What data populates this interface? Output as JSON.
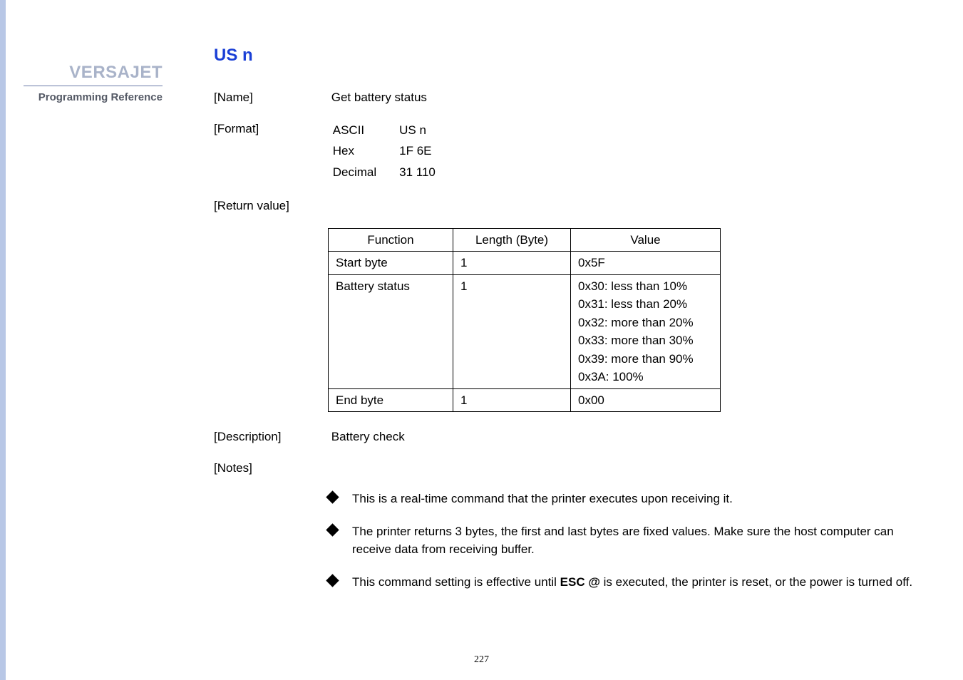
{
  "sidebar": {
    "brand": "VERSAJET",
    "subtitle": "Programming Reference"
  },
  "title": "US n",
  "name": {
    "label": "[Name]",
    "value": "Get battery status"
  },
  "format": {
    "label": "[Format]",
    "rows": [
      {
        "enc": "ASCII",
        "val": "US n"
      },
      {
        "enc": "Hex",
        "val": "1F 6E"
      },
      {
        "enc": "Decimal",
        "val": "31 110"
      }
    ]
  },
  "return_value": {
    "label": "[Return value]",
    "headers": {
      "func": "Function",
      "len": "Length (Byte)",
      "val": "Value"
    },
    "rows": [
      {
        "func": "Start byte",
        "len": "1",
        "val": [
          "0x5F"
        ]
      },
      {
        "func": "Battery status",
        "len": "1",
        "val": [
          "0x30: less than 10%",
          "0x31: less than 20%",
          "0x32: more than 20%",
          "0x33: more than 30%",
          "0x39: more than 90%",
          "0x3A: 100%"
        ]
      },
      {
        "func": "End byte",
        "len": "1",
        "val": [
          "0x00"
        ]
      }
    ]
  },
  "description": {
    "label": "[Description]",
    "value": "Battery check"
  },
  "notes": {
    "label": "[Notes]",
    "items": [
      {
        "pre": "This is a real-time command that the printer executes upon receiving it.",
        "bold": "",
        "post": ""
      },
      {
        "pre": "The printer returns 3 bytes, the first and last bytes are fixed values. Make sure the host computer can receive data from receiving buffer.",
        "bold": "",
        "post": ""
      },
      {
        "pre": "This command setting is effective until ",
        "bold": "ESC @",
        "post": " is executed, the printer is reset, or the power is turned off."
      }
    ]
  },
  "page_number": "227"
}
